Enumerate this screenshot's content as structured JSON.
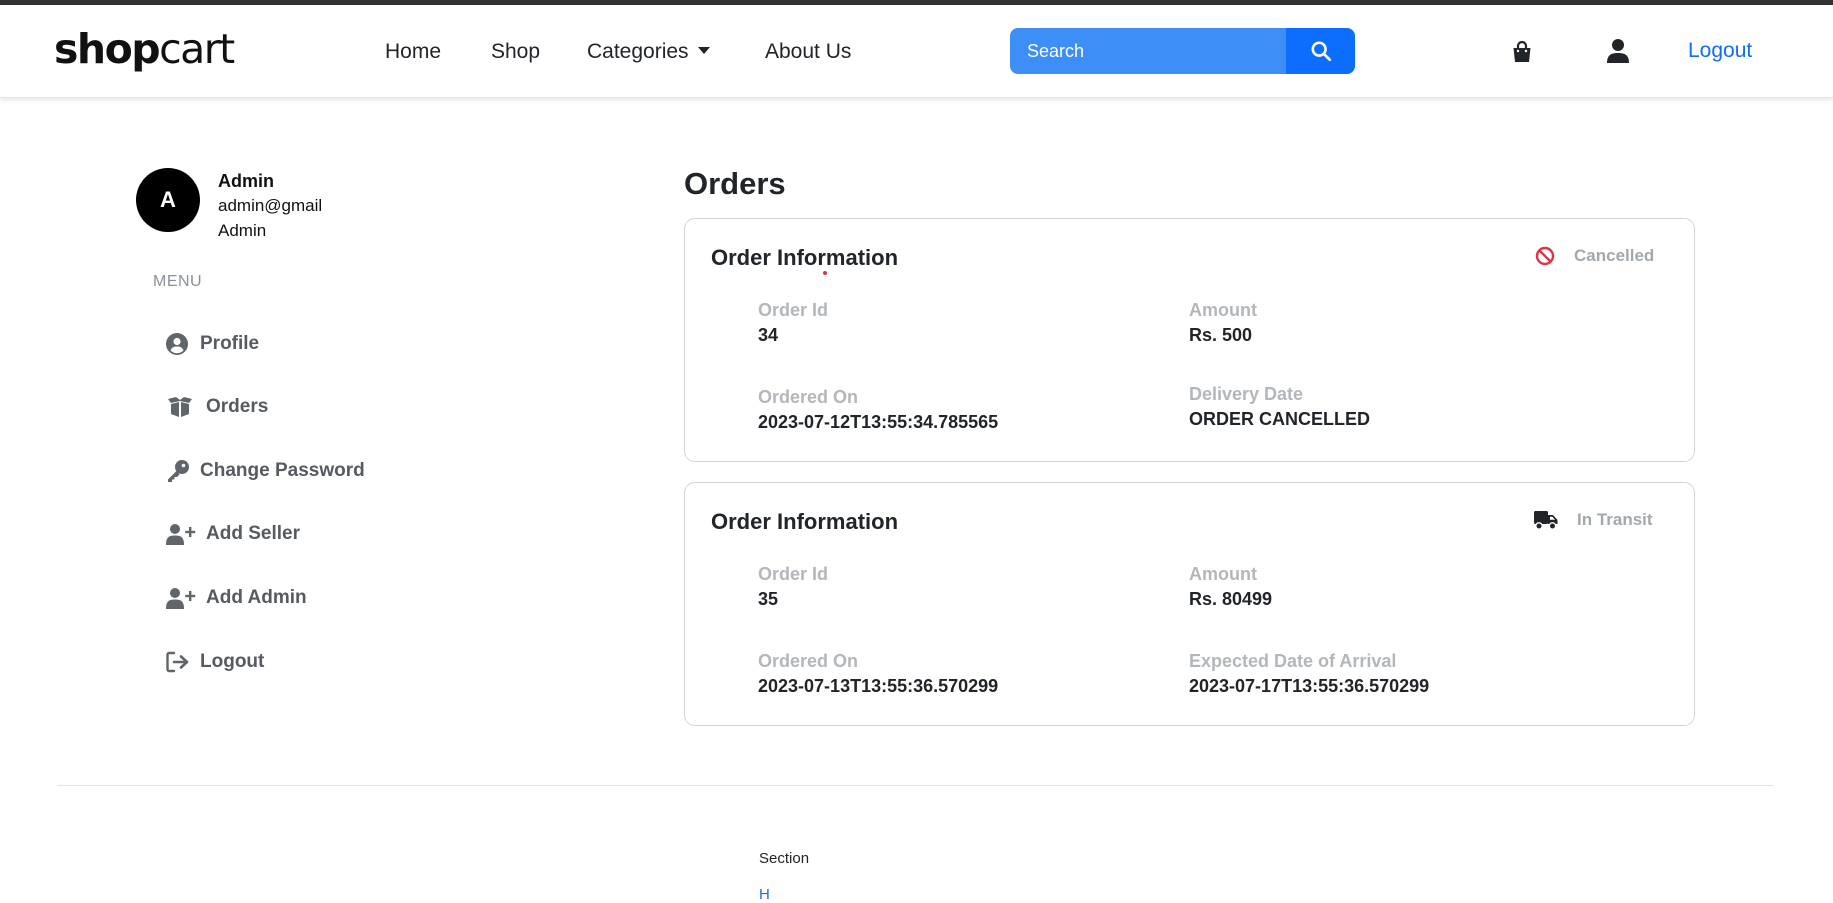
{
  "brand": {
    "part1": "shop",
    "part2": "cart"
  },
  "nav": {
    "links": [
      "Home",
      "Shop",
      "Categories",
      "About Us"
    ],
    "search_placeholder": "Search",
    "logout_label": "Logout"
  },
  "user": {
    "avatar_letter": "A",
    "name": "Admin",
    "email": "admin@gmail",
    "role": "Admin"
  },
  "sidebar": {
    "menu_label": "MENU",
    "items": [
      {
        "label": "Profile",
        "icon": "user-circle-icon"
      },
      {
        "label": "Orders",
        "icon": "boxes-icon"
      },
      {
        "label": "Change Password",
        "icon": "key-icon"
      },
      {
        "label": "Add Seller",
        "icon": "user-plus-icon"
      },
      {
        "label": "Add Admin",
        "icon": "user-plus-icon"
      },
      {
        "label": "Logout",
        "icon": "sign-out-icon"
      }
    ]
  },
  "main": {
    "title": "Orders",
    "orders": [
      {
        "card_title": "Order Information",
        "status": "Cancelled",
        "status_icon": "ban-icon",
        "status_color": "#dc3545",
        "order_id_label": "Order Id",
        "order_id": "34",
        "amount_label": "Amount",
        "amount": "Rs. 500",
        "ordered_on_label": "Ordered On",
        "ordered_on": "2023-07-12T13:55:34.785565",
        "date_label": "Delivery Date",
        "date_value": "ORDER CANCELLED"
      },
      {
        "card_title": "Order Information",
        "status": "In Transit",
        "status_icon": "truck-icon",
        "status_color": "#212529",
        "order_id_label": "Order Id",
        "order_id": "35",
        "amount_label": "Amount",
        "amount": "Rs. 80499",
        "ordered_on_label": "Ordered On",
        "ordered_on": "2023-07-13T13:55:36.570299",
        "date_label": "Expected Date of Arrival",
        "date_value": "2023-07-17T13:55:36.570299"
      }
    ]
  },
  "footer": {
    "section_heading": "Section",
    "link": "H"
  },
  "colors": {
    "accent": "#0d6efd",
    "search_bg": "#3e8ef7",
    "cancel_red": "#dc3545"
  }
}
